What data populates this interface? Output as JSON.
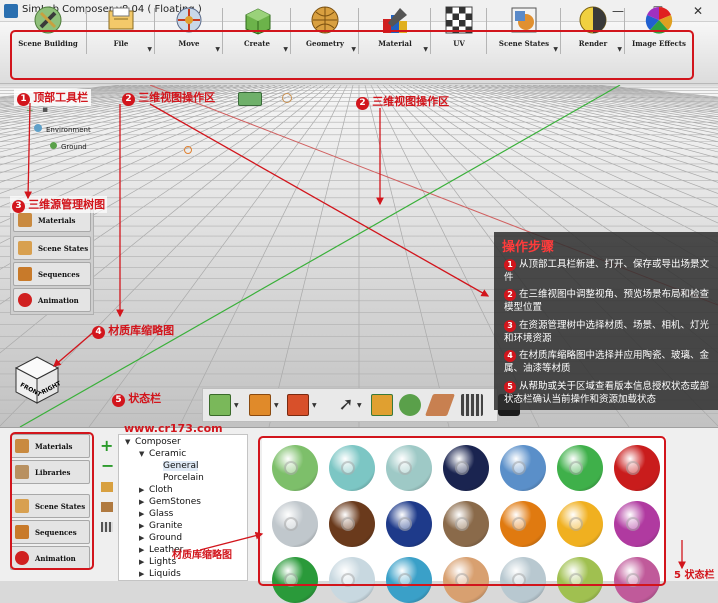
{
  "window": {
    "title": "SimLab Composer v8.04 ( Floating )",
    "minimize": "—",
    "maximize": "☐",
    "close": "✕"
  },
  "toolbar": {
    "tools": [
      {
        "label": "Scene Building",
        "icon": "scene-building-icon"
      },
      {
        "label": "File",
        "icon": "file-icon"
      },
      {
        "label": "Move",
        "icon": "move-icon"
      },
      {
        "label": "Create",
        "icon": "create-icon"
      },
      {
        "label": "Geometry",
        "icon": "geometry-icon"
      },
      {
        "label": "Material",
        "icon": "material-icon"
      },
      {
        "label": "UV",
        "icon": "uv-icon"
      },
      {
        "label": "Scene States",
        "icon": "scene-states-icon"
      },
      {
        "label": "Render",
        "icon": "render-icon"
      },
      {
        "label": "Image Effects",
        "icon": "image-effects-icon"
      }
    ]
  },
  "scene_tree": {
    "items": [
      "Environment",
      "Ground"
    ]
  },
  "side_panel": {
    "items": [
      "Materials",
      "Scene States",
      "Sequences",
      "Animation"
    ]
  },
  "view_cube": {
    "left": "FRONT",
    "right": "RIGHT"
  },
  "annotations": {
    "a1": {
      "num": "1",
      "text": "顶部工具栏"
    },
    "a2a": {
      "num": "2",
      "text": "三维视图操作区"
    },
    "a2b": {
      "num": "2",
      "text": "三维视图操作区"
    },
    "a3": {
      "num": "3",
      "text": "三维源管理树图"
    },
    "a4": {
      "num": "4",
      "text": "材质库缩略图"
    },
    "a5": {
      "num": "5",
      "text": "状态栏"
    },
    "watermark": "www.cr173.com",
    "thumb_label": "材质库缩略图",
    "status_right": "5 状态栏"
  },
  "steps": {
    "heading": "操作步骤",
    "items": [
      {
        "num": "1",
        "text": "从顶部工具栏新建、打开、保存或导出场景文件"
      },
      {
        "num": "2",
        "text": "在三维视图中调整视角、预览场景布局和检查模型位置"
      },
      {
        "num": "3",
        "text": "在资源管理树中选择材质、场景、相机、灯光和环境资源"
      },
      {
        "num": "4",
        "text": "在材质库缩略图中选择并应用陶瓷、玻璃、金属、油漆等材质"
      },
      {
        "num": "5",
        "text": "从帮助或关于区域查看版本信息授权状态或部状态栏确认当前操作和资源加载状态"
      }
    ]
  },
  "library_buttons": {
    "items": [
      "Materials",
      "Libraries",
      "Scene States",
      "Sequences",
      "Animation"
    ]
  },
  "library_tree": {
    "items": [
      {
        "label": "Composer",
        "level": 0,
        "expanded": true
      },
      {
        "label": "Ceramic",
        "level": 1,
        "expanded": true
      },
      {
        "label": "General",
        "level": 2,
        "selected": true
      },
      {
        "label": "Porcelain",
        "level": 2
      },
      {
        "label": "Cloth",
        "level": 1
      },
      {
        "label": "GemStones",
        "level": 1
      },
      {
        "label": "Glass",
        "level": 1
      },
      {
        "label": "Granite",
        "level": 1
      },
      {
        "label": "Ground",
        "level": 1
      },
      {
        "label": "Leather",
        "level": 1
      },
      {
        "label": "Lights",
        "level": 1
      },
      {
        "label": "Liquids",
        "level": 1
      }
    ]
  },
  "thumbnails": {
    "colors": [
      "#7dbf6a",
      "#7cc6c4",
      "#9ec9c6",
      "#1a2450",
      "#5a8fc9",
      "#3fb04a",
      "#c91c1c",
      "#c0c7cc",
      "#6a3a1c",
      "#1e3a8a",
      "#8a6a4a",
      "#e07a10",
      "#f0b020",
      "#b03aa0",
      "#2a9a3a",
      "#c8d8e0",
      "#3aa0c8",
      "#d8a070",
      "#b8c8d0",
      "#a0c050",
      "#c05a9a"
    ]
  }
}
